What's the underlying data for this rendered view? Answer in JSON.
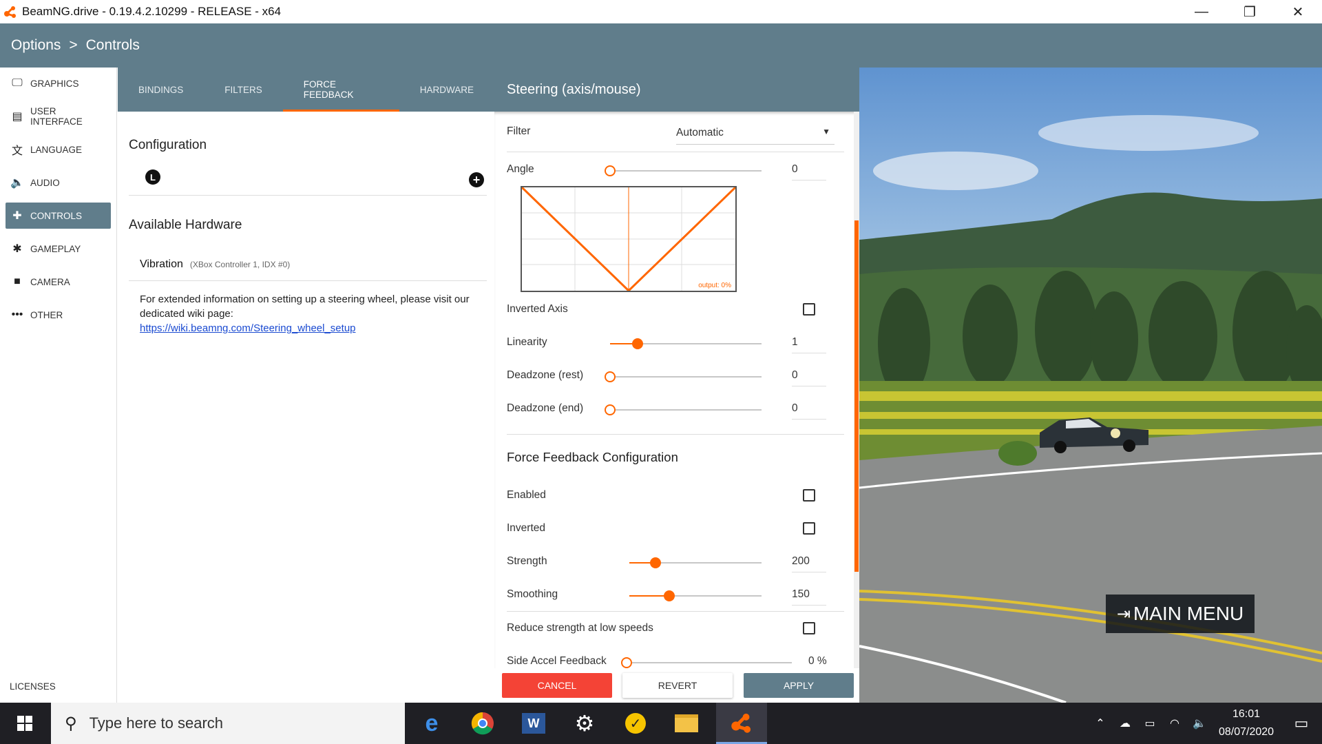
{
  "window": {
    "title": "BeamNG.drive - 0.19.4.2.10299 - RELEASE - x64",
    "minimize": "—",
    "restore": "❐",
    "close": "✕"
  },
  "breadcrumb": {
    "root": "Options",
    "separator": ">",
    "current": "Controls"
  },
  "sidebar": {
    "items": [
      {
        "label": "GRAPHICS",
        "icon": "monitor-icon",
        "glyph": "🖵"
      },
      {
        "label": "USER INTERFACE",
        "icon": "window-icon",
        "glyph": "▤"
      },
      {
        "label": "LANGUAGE",
        "icon": "translate-icon",
        "glyph": "文"
      },
      {
        "label": "AUDIO",
        "icon": "speaker-icon",
        "glyph": "🔈"
      },
      {
        "label": "CONTROLS",
        "icon": "gamepad-icon",
        "glyph": "✚"
      },
      {
        "label": "GAMEPLAY",
        "icon": "puzzle-icon",
        "glyph": "✱"
      },
      {
        "label": "CAMERA",
        "icon": "videocam-icon",
        "glyph": "■"
      },
      {
        "label": "OTHER",
        "icon": "more-icon",
        "glyph": "•••"
      }
    ],
    "active_index": 4,
    "licenses": "LICENSES"
  },
  "tabs": [
    "BINDINGS",
    "FILTERS",
    "FORCE FEEDBACK",
    "HARDWARE"
  ],
  "active_tab": 2,
  "left": {
    "configuration_title": "Configuration",
    "config_glyph": "L",
    "add_glyph": "+",
    "available_hardware_title": "Available Hardware",
    "hardware_name": "Vibration",
    "hardware_sub": "(XBox Controller 1, IDX #0)",
    "info_text": "For extended information on setting up a steering wheel, please visit our dedicated wiki page:",
    "info_link": "https://wiki.beamng.com/Steering_wheel_setup"
  },
  "steering": {
    "title": "Steering (axis/mouse)",
    "filter_label": "Filter",
    "filter_value": "Automatic",
    "angle_label": "Angle",
    "angle_value": "0",
    "graph_output": "output: 0%",
    "inverted_axis_label": "Inverted Axis",
    "linearity_label": "Linearity",
    "linearity_value": "1",
    "deadzone_rest_label": "Deadzone (rest)",
    "deadzone_rest_value": "0",
    "deadzone_end_label": "Deadzone (end)",
    "deadzone_end_value": "0",
    "ffb_title": "Force Feedback Configuration",
    "enabled_label": "Enabled",
    "inverted_label": "Inverted",
    "strength_label": "Strength",
    "strength_value": "200",
    "smoothing_label": "Smoothing",
    "smoothing_value": "150",
    "reduce_label": "Reduce strength at low speeds",
    "side_accel_label": "Side Accel Feedback",
    "side_accel_value": "0 %"
  },
  "slider_levels": {
    "angle": 0,
    "linearity": 0.18,
    "deadzone_rest": 0,
    "deadzone_end": 0,
    "strength": 0.2,
    "smoothing": 0.3,
    "side_accel": 0
  },
  "buttons": {
    "cancel": "CANCEL",
    "revert": "REVERT",
    "apply": "APPLY"
  },
  "scene": {
    "main_menu": "MAIN MENU"
  },
  "taskbar": {
    "search_placeholder": "Type here to search",
    "apps": [
      "edge-icon",
      "chrome-icon",
      "word-icon",
      "settings-icon",
      "norton-icon",
      "file-explorer-icon",
      "beamng-icon"
    ],
    "time": "16:01",
    "date": "08/07/2020"
  },
  "colors": {
    "accent": "#ff6600",
    "header": "#607d8b",
    "cancel": "#f44336"
  }
}
